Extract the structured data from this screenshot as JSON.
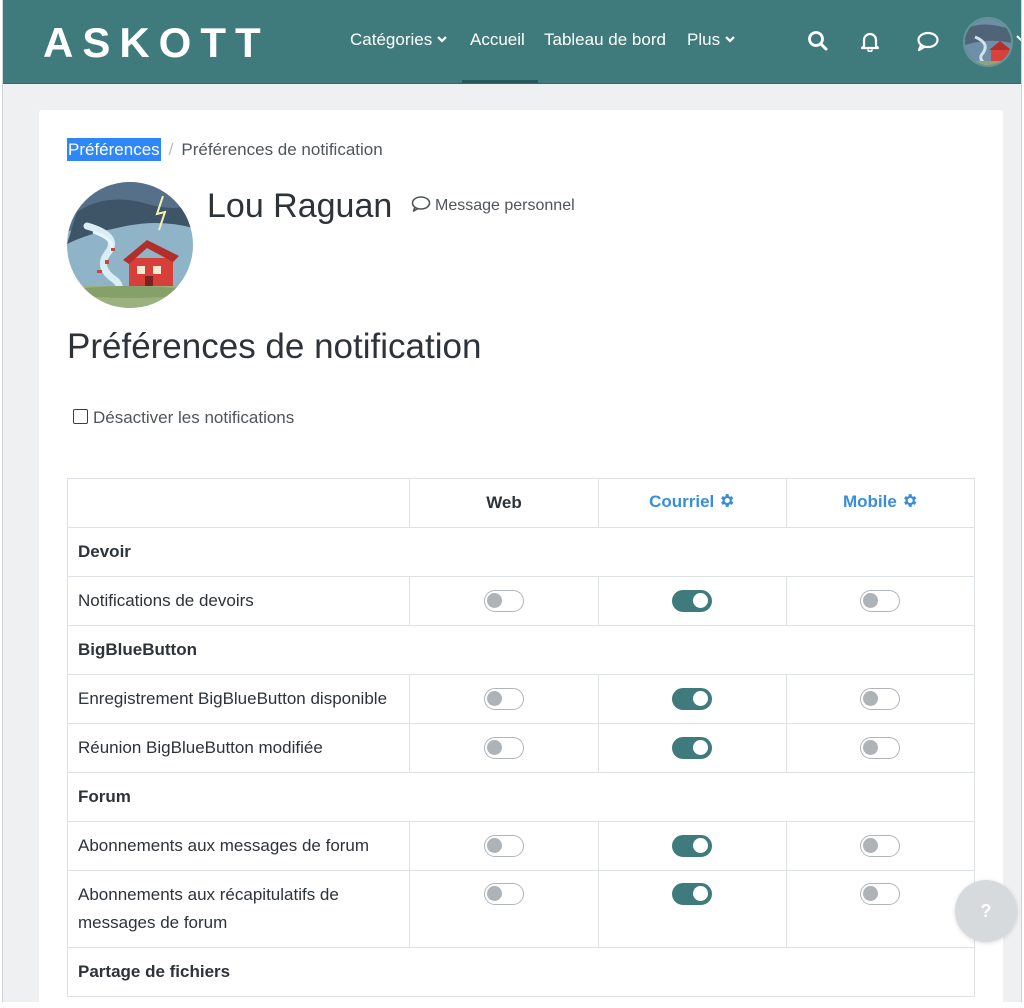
{
  "nav": {
    "logo": "ASKOTT",
    "categories_label": "Catégories",
    "home_label": "Accueil",
    "dashboard_label": "Tableau de bord",
    "more_label": "Plus"
  },
  "breadcrumb": {
    "preferences": "Préférences",
    "current": "Préférences de notification"
  },
  "user": {
    "name": "Lou Raguan",
    "message_link": "Message personnel"
  },
  "page_title": "Préférences de notification",
  "disable_notifications_label": "Désactiver les notifications",
  "table": {
    "headers": {
      "web": "Web",
      "email": "Courriel",
      "mobile": "Mobile"
    },
    "groups": [
      {
        "name": "Devoir",
        "rows": [
          {
            "label": "Notifications de devoirs",
            "web": false,
            "email": true,
            "mobile": false
          }
        ]
      },
      {
        "name": "BigBlueButton",
        "rows": [
          {
            "label": "Enregistrement BigBlueButton disponible",
            "web": false,
            "email": true,
            "mobile": false
          },
          {
            "label": "Réunion BigBlueButton modifiée",
            "web": false,
            "email": true,
            "mobile": false
          }
        ]
      },
      {
        "name": "Forum",
        "rows": [
          {
            "label": "Abonnements aux messages de forum",
            "web": false,
            "email": true,
            "mobile": false
          },
          {
            "label": "Abonnements aux récapitulatifs de messages de forum",
            "web": false,
            "email": true,
            "mobile": false
          }
        ]
      },
      {
        "name": "Partage de fichiers",
        "rows": []
      }
    ]
  },
  "help_button": "?",
  "colors": {
    "brand": "#3f7b7c",
    "link": "#3b8ed6",
    "selection": "#2f86f6"
  }
}
